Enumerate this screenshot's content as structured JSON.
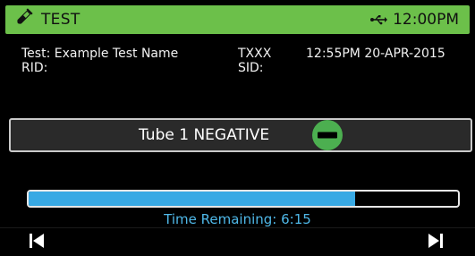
{
  "header": {
    "title": "TEST",
    "time": "12:00PM",
    "title_icon": "test-tube-icon",
    "status_icon": "usb-icon",
    "color": "#6cc04a"
  },
  "info": {
    "test_label": "Test: Example Test Name",
    "rid_label": "RID:",
    "test_code": "TXXX",
    "sid_label": "SID:",
    "datetime": "12:55PM 20-APR-2015"
  },
  "result": {
    "text": "Tube 1 NEGATIVE",
    "icon": "negative-minus-icon",
    "icon_color": "#4caf50"
  },
  "progress": {
    "fraction": 0.76,
    "color": "#38a9e4"
  },
  "time_remaining": "Time Remaining:  6:15",
  "nav": {
    "prev_icon": "skip-previous-icon",
    "next_icon": "skip-next-icon"
  }
}
